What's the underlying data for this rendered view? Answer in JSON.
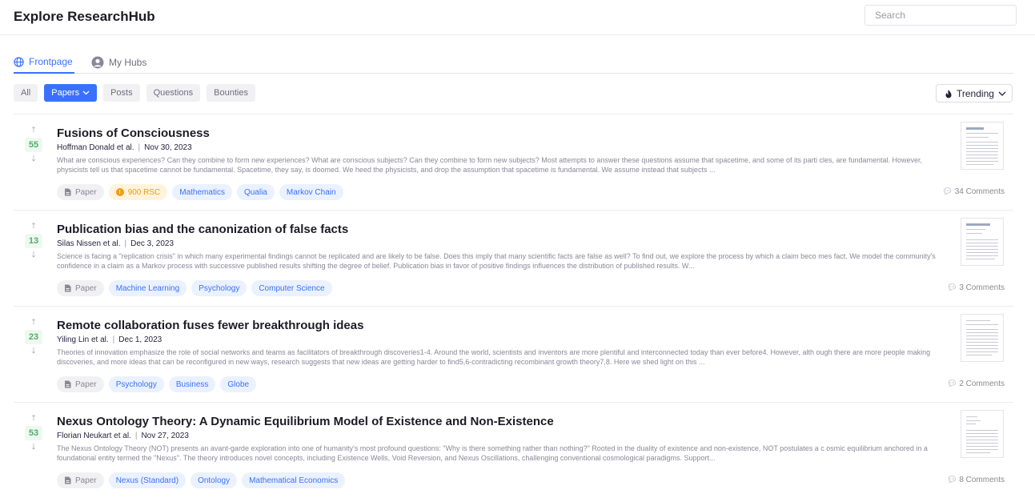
{
  "header": {
    "title": "Explore ResearchHub",
    "search_placeholder": "Search"
  },
  "tabs": [
    {
      "label": "Frontpage",
      "icon": "globe-icon",
      "active": true
    },
    {
      "label": "My Hubs",
      "icon": "user-icon",
      "active": false
    }
  ],
  "filters": [
    {
      "label": "All",
      "active": false
    },
    {
      "label": "Papers",
      "active": true,
      "has_dropdown": true
    },
    {
      "label": "Posts",
      "active": false
    },
    {
      "label": "Questions",
      "active": false
    },
    {
      "label": "Bounties",
      "active": false
    }
  ],
  "sort": {
    "label": "Trending",
    "icon": "flame-icon"
  },
  "colors": {
    "accent": "#3971ff",
    "score_green": "#4cb06a",
    "rsc_orange": "#f29a0f"
  },
  "items": [
    {
      "score": "55",
      "title": "Fusions of Consciousness",
      "authors": "Hoffman Donald et al.",
      "date": "Nov 30, 2023",
      "abstract": "What are conscious experiences? Can they combine to form new experiences? What are conscious subjects? Can they combine to form new subjects? Most attempts to answer these questions assume that spacetime, and some of its parti cles, are fundamental. However, physicists tell us that spacetime cannot be fundamental. Spacetime, they say, is doomed. We heed the physicists, and drop the assumption that spacetime is fundamental. We assume instead that subjects ...",
      "type_label": "Paper",
      "bounty": "900 RSC",
      "hubs": [
        "Mathematics",
        "Qualia",
        "Markov Chain"
      ],
      "comments": "34 Comments"
    },
    {
      "score": "13",
      "title": "Publication bias and the canonization of false facts",
      "authors": "Silas Nissen et al.",
      "date": "Dec 3, 2023",
      "abstract": "Science is facing a \"replication crisis\" in which many experimental findings cannot be replicated and are likely to be false. Does this imply that many scientific facts are false as well? To find out, we explore the process by which a claim beco mes fact. We model the community's confidence in a claim as a Markov process with successive published results shifting the degree of belief. Publication bias in favor of positive findings influences the distribution of published results. W...",
      "type_label": "Paper",
      "hubs": [
        "Machine Learning",
        "Psychology",
        "Computer Science"
      ],
      "comments": "3 Comments"
    },
    {
      "score": "23",
      "title": "Remote collaboration fuses fewer breakthrough ideas",
      "authors": "Yiling Lin et al.",
      "date": "Dec 1, 2023",
      "abstract": "Theories of innovation emphasize the role of social networks and teams as facilitators of breakthrough discoveries1-4. Around the world, scientists and inventors are more plentiful and interconnected today than ever before4. However, alth ough there are more people making discoveries, and more ideas that can be reconfigured in new ways, research suggests that new ideas are getting harder to find5,6-contradicting recombinant growth theory7,8. Here we shed light on this ...",
      "type_label": "Paper",
      "hubs": [
        "Psychology",
        "Business",
        "Globe"
      ],
      "comments": "2 Comments"
    },
    {
      "score": "53",
      "title": "Nexus Ontology Theory: A Dynamic Equilibrium Model of Existence and Non-Existence",
      "authors": "Florian Neukart et al.",
      "date": "Nov 27, 2023",
      "abstract": "The Nexus Ontology Theory (NOT) presents an avant-garde exploration into one of humanity's most profound questions: \"Why is there something rather than nothing?\" Rooted in the duality of existence and non-existence, NOT postulates a c osmic equilibrium anchored in a foundational entity termed the \"Nexus\". The theory introduces novel concepts, including Existence Wells, Void Reversion, and Nexus Oscillations, challenging conventional cosmological paradigms. Support...",
      "type_label": "Paper",
      "hubs": [
        "Nexus (Standard)",
        "Ontology",
        "Mathematical Economics"
      ],
      "comments": "8 Comments"
    }
  ]
}
